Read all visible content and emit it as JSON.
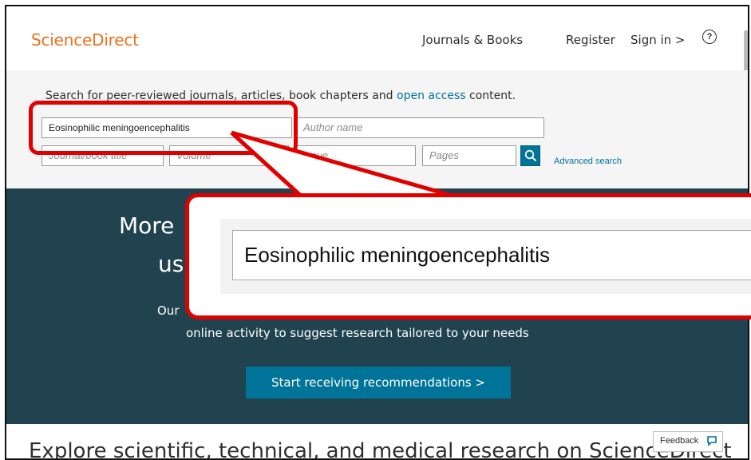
{
  "header": {
    "brand": "ScienceDirect",
    "journals_books": "Journals & Books",
    "register": "Register",
    "sign_in": "Sign in >",
    "help": "?"
  },
  "search": {
    "intro_prefix": "Search for peer-reviewed journals, articles, book chapters and ",
    "intro_link": "open access",
    "intro_suffix": " content.",
    "keywords_value": "Eosinophilic meningoencephalitis",
    "author_placeholder": "Author name",
    "journal_placeholder": "Journal/book title",
    "volume_placeholder": "Volume",
    "issue_placeholder": "Issue",
    "pages_placeholder": "Pages",
    "advanced_search": "Advanced search"
  },
  "promo": {
    "heading_line1": "More",
    "heading_line2": "us",
    "body_line1": "Our",
    "body_line2": "online activity to suggest research tailored to your needs",
    "cta": "Start receiving recommendations >"
  },
  "bottom": {
    "text": "Explore scientific, technical, and medical research on ScienceDirect",
    "feedback": "Feedback"
  },
  "callout": {
    "zoom_value": "Eosinophilic meningoencephalitis"
  },
  "colors": {
    "brand": "#e9711c",
    "accent": "#007398",
    "promo_bg": "#20434f",
    "annotation": "#e00000"
  }
}
